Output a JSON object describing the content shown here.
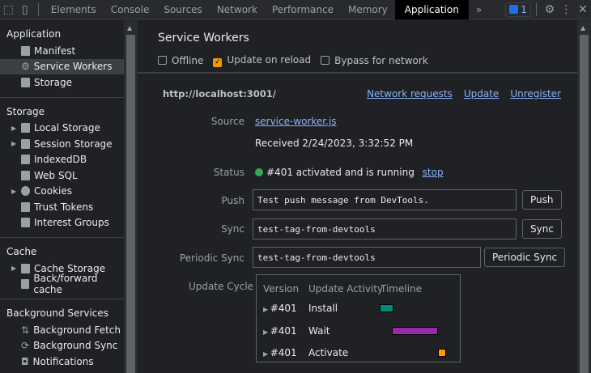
{
  "toolbar": {
    "tabs": [
      "Elements",
      "Console",
      "Sources",
      "Network",
      "Performance",
      "Memory",
      "Application"
    ],
    "more": "»",
    "issues_count": "1"
  },
  "sidebar": {
    "application_header": "Application",
    "application_items": [
      "Manifest",
      "Service Workers",
      "Storage"
    ],
    "storage_header": "Storage",
    "storage_items": [
      "Local Storage",
      "Session Storage",
      "IndexedDB",
      "Web SQL",
      "Cookies",
      "Trust Tokens",
      "Interest Groups"
    ],
    "cache_header": "Cache",
    "cache_items": [
      "Cache Storage",
      "Back/forward cache"
    ],
    "bg_header": "Background Services",
    "bg_items": [
      "Background Fetch",
      "Background Sync",
      "Notifications"
    ]
  },
  "main": {
    "title": "Service Workers",
    "options": [
      {
        "label": "Offline",
        "checked": false
      },
      {
        "label": "Update on reload",
        "checked": true
      },
      {
        "label": "Bypass for network",
        "checked": false
      }
    ],
    "origin": "http://localhost:3001/",
    "links": [
      "Network requests",
      "Update",
      "Unregister"
    ],
    "source_label": "Source",
    "source_file": "service-worker.js",
    "received": "Received 2/24/2023, 3:32:52 PM",
    "status_label": "Status",
    "status_text": "#401 activated and is running",
    "stop": "stop",
    "push_label": "Push",
    "push_value": "Test push message from DevTools.",
    "push_button": "Push",
    "sync_label": "Sync",
    "sync_value": "test-tag-from-devtools",
    "sync_button": "Sync",
    "periodic_label": "Periodic Sync",
    "periodic_value": "test-tag-from-devtools",
    "periodic_button": "Periodic Sync",
    "update_cycle_label": "Update Cycle",
    "cycle_headers": [
      "Version",
      "Update Activity",
      "Timeline"
    ],
    "cycle_rows": [
      {
        "version": "#401",
        "activity": "Install",
        "color": "#00897b"
      },
      {
        "version": "#401",
        "activity": "Wait",
        "color": "#9c27b0"
      },
      {
        "version": "#401",
        "activity": "Activate",
        "color": "#ff9800"
      }
    ]
  }
}
